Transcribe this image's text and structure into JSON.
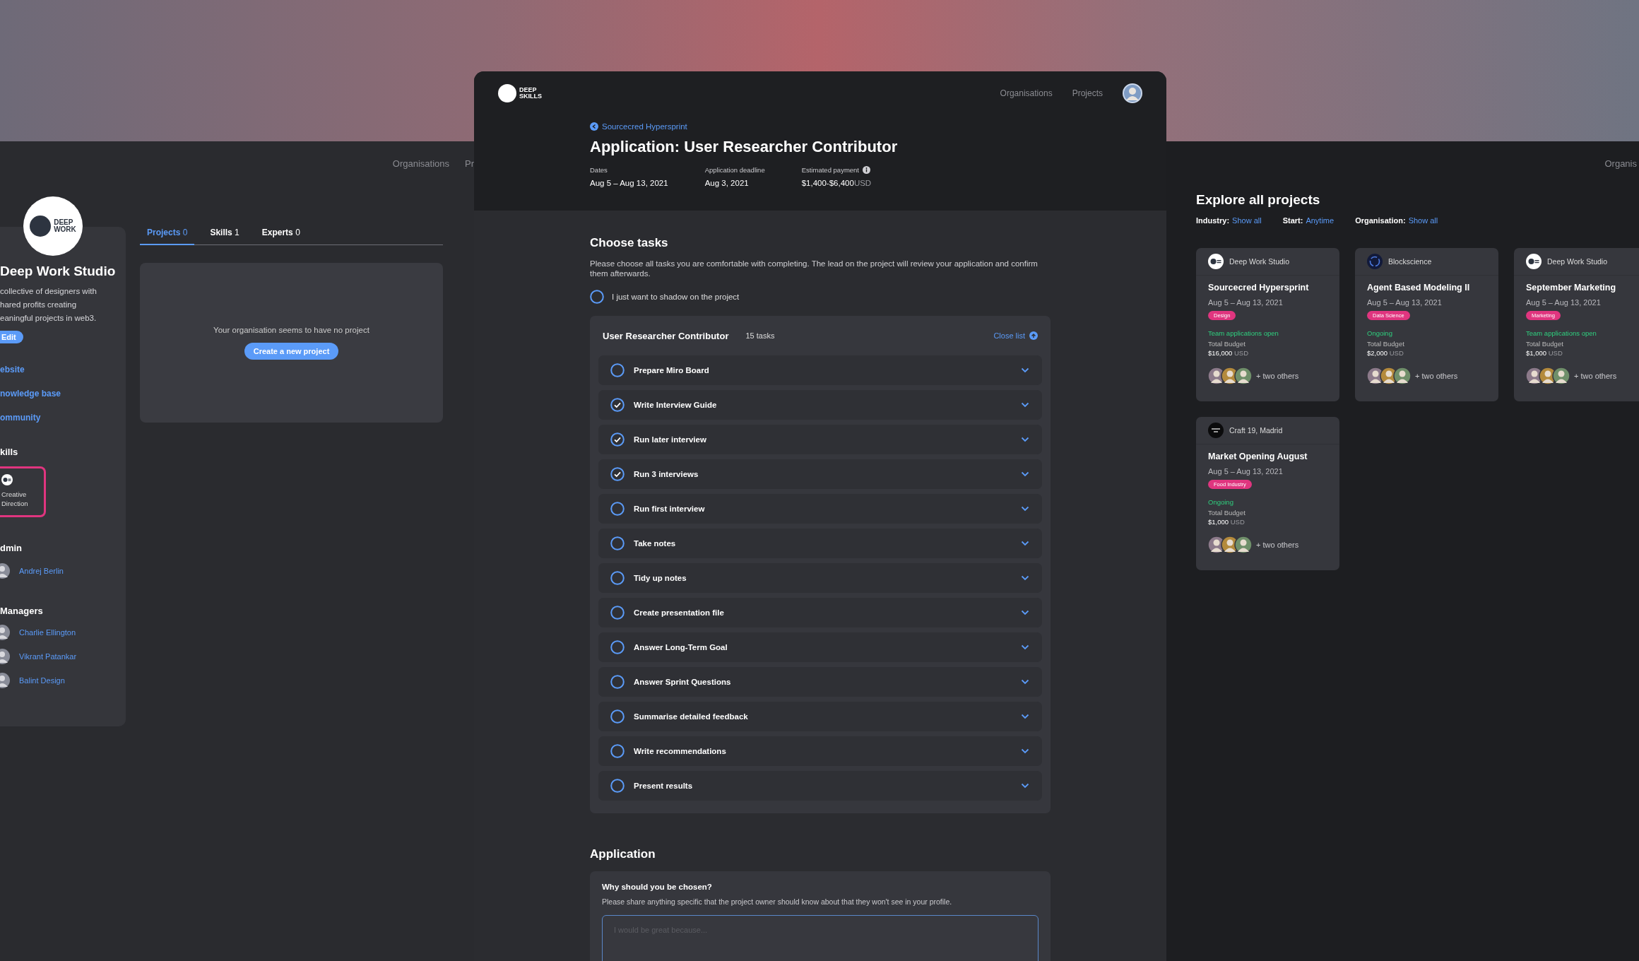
{
  "left_screen": {
    "nav": [
      "Organisations",
      "Pr"
    ],
    "org": {
      "name": "Deep Work Studio",
      "logo_text": "DEEP\nWORK",
      "description": "collective of designers with\nhared profits creating\neaningful projects in web3.",
      "edit_button": "Edit",
      "links": [
        "ebsite",
        "nowledge base",
        "ommunity"
      ],
      "skills_heading": "kills",
      "skills": [
        {
          "label": "Creative Direction"
        }
      ],
      "admin_heading": "dmin",
      "admins": [
        {
          "name": "Andrej Berlin"
        }
      ],
      "managers_heading": "Managers",
      "managers": [
        {
          "name": "Charlie Ellington"
        },
        {
          "name": "Vikrant Patankar"
        },
        {
          "name": "Balint Design"
        }
      ]
    },
    "tabs": [
      {
        "label": "Projects",
        "count": "0",
        "selected": true
      },
      {
        "label": "Skills",
        "count": "1",
        "selected": false
      },
      {
        "label": "Experts",
        "count": "0",
        "selected": false
      }
    ],
    "empty_state": {
      "message": "Your organisation seems to have no project",
      "button": "Create a new project"
    }
  },
  "main_window": {
    "logo_text": "DEEP\nSKILLS",
    "nav": [
      "Organisations",
      "Projects"
    ],
    "back_link": "Sourcecred Hypersprint",
    "title": "Application: User Researcher Contributor",
    "meta": [
      {
        "label": "Dates",
        "value": "Aug 5 – Aug 13, 2021",
        "info": false
      },
      {
        "label": "Application deadline",
        "value": "Aug 3, 2021",
        "info": false
      },
      {
        "label": "Estimated payment",
        "value": "$1,400-$6,400",
        "unit": "USD",
        "info": true
      }
    ],
    "choose_tasks": {
      "heading": "Choose tasks",
      "description": "Please choose all tasks you are comfortable with completing. The lead on the project will review your application and confirm them afterwards.",
      "shadow_option": {
        "label": "I just want to shadow on the project",
        "checked": false
      },
      "list": {
        "title": "User Researcher Contributor",
        "count": "15 tasks",
        "close_link": "Close list",
        "tasks": [
          {
            "label": "Prepare Miro Board",
            "checked": false
          },
          {
            "label": "Write Interview Guide",
            "checked": true
          },
          {
            "label": "Run later interview",
            "checked": true
          },
          {
            "label": "Run 3 interviews",
            "checked": true
          },
          {
            "label": "Run first interview",
            "checked": false
          },
          {
            "label": "Take notes",
            "checked": false
          },
          {
            "label": "Tidy up notes",
            "checked": false
          },
          {
            "label": "Create presentation file",
            "checked": false
          },
          {
            "label": "Answer Long-Term Goal",
            "checked": false
          },
          {
            "label": "Answer Sprint Questions",
            "checked": false
          },
          {
            "label": "Summarise detailed feedback",
            "checked": false
          },
          {
            "label": "Write recommendations",
            "checked": false
          },
          {
            "label": "Present results",
            "checked": false
          }
        ]
      }
    },
    "application": {
      "heading": "Application",
      "question": "Why should you be chosen?",
      "hint": "Please share anything specific that the project owner should know about that they won't see in your profile.",
      "placeholder": "I would be great because..."
    }
  },
  "right_screen": {
    "nav": [
      "Organis"
    ],
    "heading": "Explore all projects",
    "filters": [
      {
        "label": "Industry:",
        "value": "Show all"
      },
      {
        "label": "Start:",
        "value": "Anytime"
      },
      {
        "label": "Organisation:",
        "value": "Show all"
      }
    ],
    "cards": [
      {
        "org": "Deep Work Studio",
        "kind": "deepwork",
        "title": "Sourcecred Hypersprint",
        "dates": "Aug 5 – Aug 13, 2021",
        "tag": "Design",
        "status": "Team applications open",
        "budget_label": "Total Budget",
        "budget": "$16,000",
        "currency": "USD",
        "others": "+ two others"
      },
      {
        "org": "Blockscience",
        "kind": "ring",
        "title": "Agent Based Modeling II",
        "dates": "Aug 5 – Aug 13, 2021",
        "tag": "Data Science",
        "status": "Ongoing",
        "budget_label": "Total Budget",
        "budget": "$2,000",
        "currency": "USD",
        "others": "+ two others"
      },
      {
        "org": "Deep Work Studio",
        "kind": "deepwork",
        "title": "September Marketing",
        "dates": "Aug 5 – Aug 13, 2021",
        "tag": "Marketing",
        "status": "Team applications open",
        "budget_label": "Total Budget",
        "budget": "$1,000",
        "currency": "USD",
        "others": "+ two others"
      },
      {
        "org": "Craft 19, Madrid",
        "kind": "dark",
        "title": "Market Opening August",
        "dates": "Aug 5 – Aug 13, 2021",
        "tag": "Food Industry",
        "status": "Ongoing",
        "budget_label": "Total Budget",
        "budget": "$1,000",
        "currency": "USD",
        "others": "+ two others"
      }
    ]
  }
}
